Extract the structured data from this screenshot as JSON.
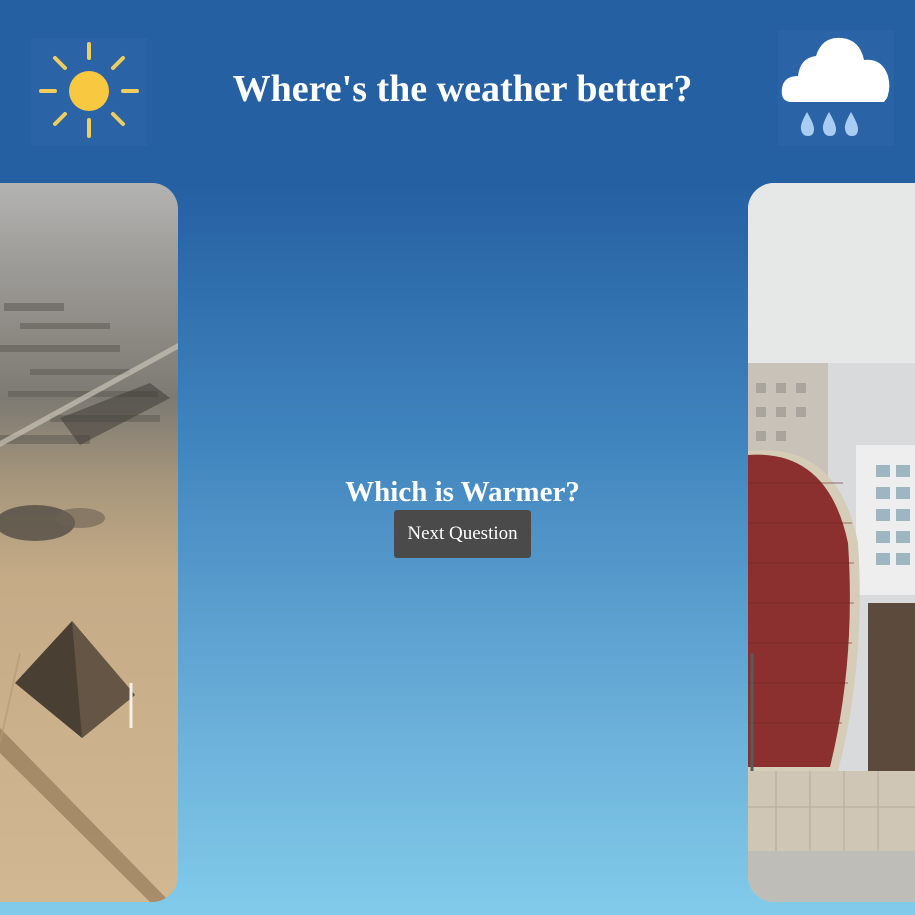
{
  "header": {
    "title": "Where's the weather better?",
    "left_icon": "sun-icon",
    "right_icon": "rain-cloud-icon"
  },
  "quiz": {
    "question": "Which is Warmer?",
    "next_button_label": "Next Question"
  },
  "cards": {
    "left_image": "pyramids-aerial-photo",
    "right_image": "city-brick-monument-photo"
  },
  "colors": {
    "header_bg": "#2560a2",
    "gradient_bottom": "#82cbea",
    "button_bg": "#4a4a4a",
    "sun": "#f7c840",
    "text": "#ffffff"
  }
}
